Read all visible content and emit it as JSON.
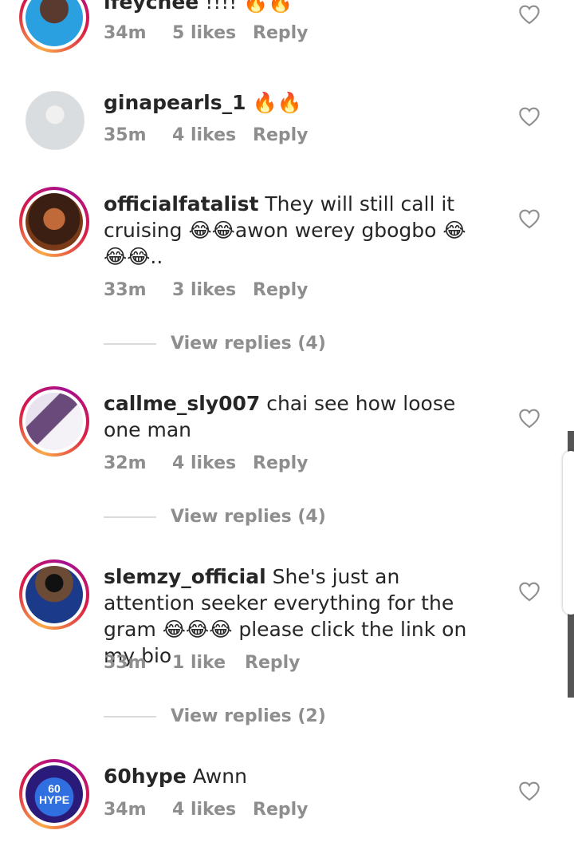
{
  "comments": [
    {
      "username": "ifeychee",
      "text": "!!!! 🔥🔥",
      "time": "34m",
      "likes": "5 likes",
      "reply": "Reply"
    },
    {
      "username": "ginapearls_1",
      "text": "🔥🔥",
      "time": "35m",
      "likes": "4 likes",
      "reply": "Reply"
    },
    {
      "username": "officialfatalist",
      "text": "They will still call it cruising 😂😂awon werey gbogbo 😂😂😂..",
      "time": "33m",
      "likes": "3 likes",
      "reply": "Reply",
      "view_replies": "View replies (4)"
    },
    {
      "username": "callme_sly007",
      "text": "chai see how loose one man",
      "time": "32m",
      "likes": "4 likes",
      "reply": "Reply",
      "view_replies": "View replies (4)"
    },
    {
      "username": "slemzy_official",
      "text": "She's just an attention seeker everything for the gram 😂😂😂 please click the link on my bio",
      "time": "33m",
      "likes": "1 like",
      "reply": "Reply",
      "view_replies": "View replies (2)"
    },
    {
      "username": "60hype",
      "text": "Awnn",
      "time": "34m",
      "likes": "4 likes",
      "reply": "Reply"
    }
  ],
  "avatar_60hype_text": "60 HYPE",
  "colors": {
    "text": "#262626",
    "muted": "#8e8e8e",
    "divider": "#dbdbdb",
    "story_ring_start": "#fbaa47",
    "story_ring_end": "#a60f93"
  },
  "icons": {
    "like": "heart-outline-icon"
  }
}
